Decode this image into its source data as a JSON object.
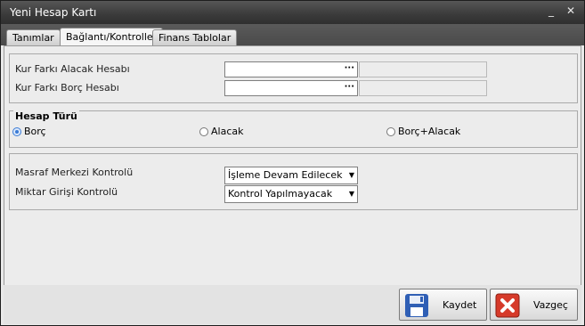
{
  "window": {
    "title": "Yeni Hesap Kartı",
    "minimize": "_",
    "close": "✕"
  },
  "tabs": [
    {
      "label": "Tanımlar"
    },
    {
      "label": "Bağlantı/Kontroller"
    },
    {
      "label": "Finans Tablolar"
    }
  ],
  "active_tab": "Bağlantı/Kontroller",
  "accounts": {
    "kur_farki_alacak_label": "Kur Farkı Alacak Hesabı",
    "kur_farki_alacak_value": "",
    "kur_farki_borc_label": "Kur Farkı Borç Hesabı",
    "kur_farki_borc_value": "",
    "lookup_glyph": "···"
  },
  "hesap_turu": {
    "title": "Hesap Türü",
    "options": [
      {
        "label": "Borç",
        "selected": true
      },
      {
        "label": "Alacak",
        "selected": false
      },
      {
        "label": "Borç+Alacak",
        "selected": false
      }
    ]
  },
  "controls": {
    "masraf_label": "Masraf Merkezi Kontrolü",
    "masraf_value": "İşleme Devam Edilecek",
    "miktar_label": "Miktar Girişi Kontrolü",
    "miktar_value": "Kontrol Yapılmayacak"
  },
  "buttons": {
    "save": "Kaydet",
    "cancel": "Vazgeç"
  },
  "colors": {
    "titlebar": "#3c3c3c",
    "radio_accent": "#3a7bd5",
    "cancel_icon": "#d63a2a",
    "save_icon": "#2f5fb5"
  }
}
